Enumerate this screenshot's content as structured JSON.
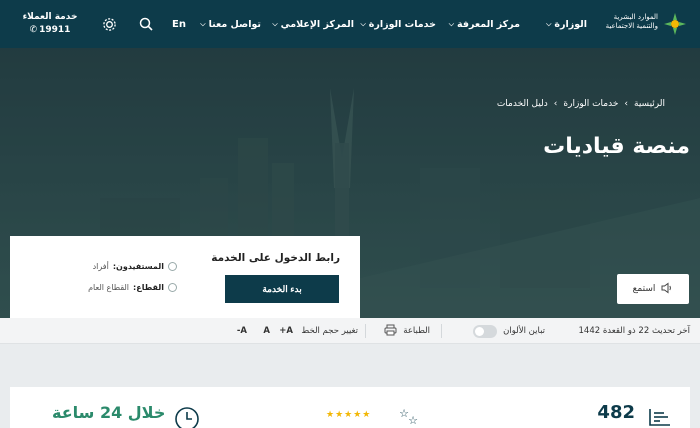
{
  "header": {
    "logo_text_line1": "الموارد البشرية",
    "logo_text_line2": "والتنمية الاجتماعية",
    "nav": [
      {
        "label": "الوزارة"
      },
      {
        "label": "مركز المعرفة"
      },
      {
        "label": "خدمات الوزارة"
      },
      {
        "label": "المركز الإعلامي"
      },
      {
        "label": "تواصل معنا"
      }
    ],
    "lang_label": "En",
    "customer_service_label": "خدمة العملاء",
    "customer_service_number": "19911",
    "icons": [
      "search-icon",
      "gear-icon",
      "phone-icon",
      "chevron-down-icon"
    ]
  },
  "breadcrumb": [
    "الرئيسية",
    "خدمات الوزارة",
    "دليل الخدمات"
  ],
  "page_title": "منصة قياديات",
  "service_card": {
    "link_label": "رابط الدخول على الخدمة",
    "start_button": "بدء الخدمة",
    "beneficiaries_label": "المستفيدون:",
    "beneficiaries_value": "أفراد",
    "sector_label": "القطاع:",
    "sector_value": "القطاع العام"
  },
  "listen_label": "استمع",
  "toolbar": {
    "last_update": "آخر تحديث 22 ذو القعدة 1442",
    "contrast_label": "تباين الألوان",
    "print_label": "الطباعة",
    "font_size_label": "تغيير حجم الخط",
    "font_plus": "A+",
    "font_normal": "A",
    "font_minus": "A-"
  },
  "stats": {
    "count": "482",
    "stars": "★★★★★",
    "duration": "خلال 24 ساعة"
  },
  "colors": {
    "header_bg": "#0d3b4a",
    "accent_green": "#2b8a6b",
    "star": "#f2b705"
  }
}
